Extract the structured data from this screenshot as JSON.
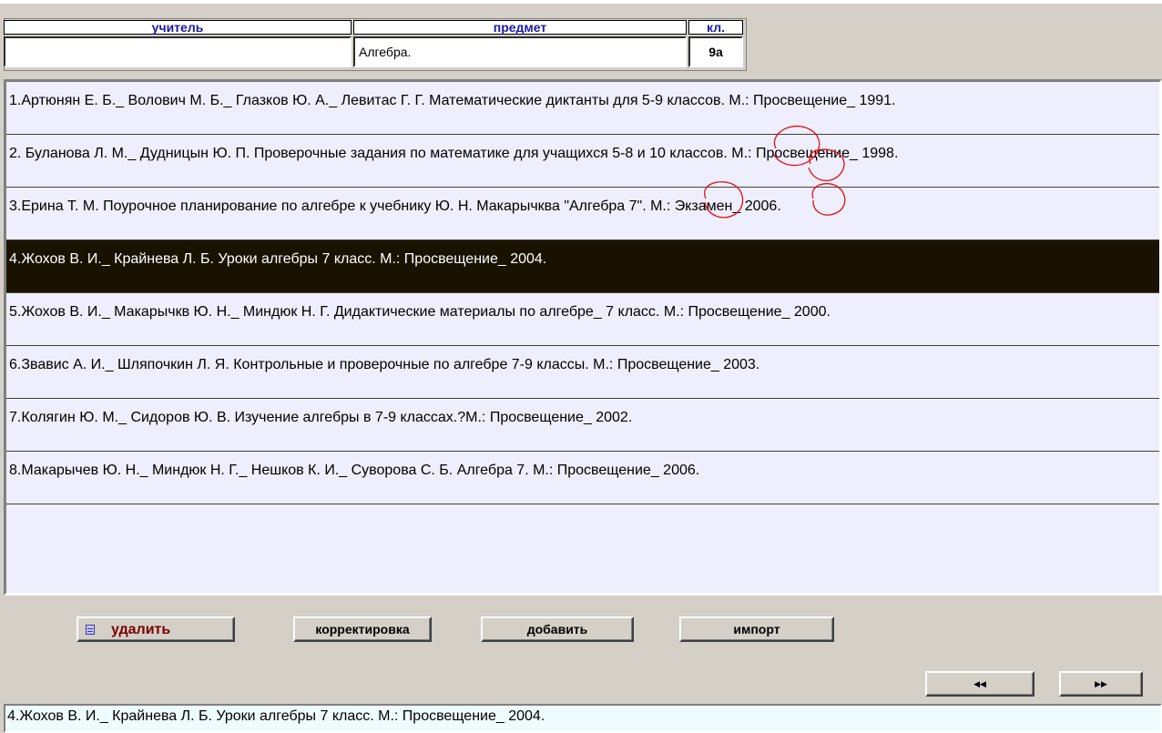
{
  "header": {
    "teacher_label": "учитель",
    "subject_label": "предмет",
    "class_label": "кл.",
    "teacher_value": "",
    "subject_value": "Алгебра.",
    "class_value": "9а"
  },
  "list": {
    "selected_index": 3,
    "rows": [
      "1.Артюнян Е. Б._ Волович М. Б._ Глазков Ю. А._ Левитас Г. Г. Математические диктанты для 5-9 классов. М.: Просвещение_ 1991.",
      "2. Буланова Л. М._ Дудницын Ю. П. Проверочные задания по математике для учащихся 5-8 и 10 классов. М.: Просвещение_ 1998.",
      "3.Ерина Т. М. Поурочное планирование по алгебре к учебнику Ю. Н. Макарычква \"Алгебра 7\". М.: Экзамен_ 2006.",
      "4.Жохов В. И._ Крайнева Л. Б. Уроки алгебры 7 класс.  М.: Просвещение_ 2004.",
      "5.Жохов В. И._ Макарычкв Ю. Н._ Миндюк Н. Г. Дидактические материалы по алгебре_ 7 класс.  М.: Просвещение_ 2000.",
      "6.Звавис А. И._ Шляпочкин Л. Я. Контрольные и проверочные по алгебре 7-9 классы. М.: Просвещение_ 2003.",
      "7.Колягин Ю. М._ Сидоров Ю. В. Изучение алгебры в 7-9 классах.?М.: Просвещение_ 2002.",
      "8.Макарычев Ю. Н._ Миндюк Н. Г._ Нешков К. И._ Суворова С. Б. Алгебра 7.  М.: Просвещение_ 2006."
    ]
  },
  "toolbar": {
    "delete_label": "удалить",
    "edit_label": "корректировка",
    "add_label": "добавить",
    "import_label": "импорт",
    "delete_icon": "table-icon"
  },
  "pager": {
    "prev_label": "◀◀",
    "next_label": "▶▶"
  },
  "status": {
    "text": "4.Жохов В. И._ Крайнева Л. Б. Уроки алгебры 7 класс.  М.: Просвещение_ 2004."
  },
  "colors": {
    "header_label": "#1a1aa6",
    "list_background": "#eeeefc",
    "selected_row": "#1a1200",
    "delete_text": "#7b0000",
    "annotation": "#e01010"
  }
}
